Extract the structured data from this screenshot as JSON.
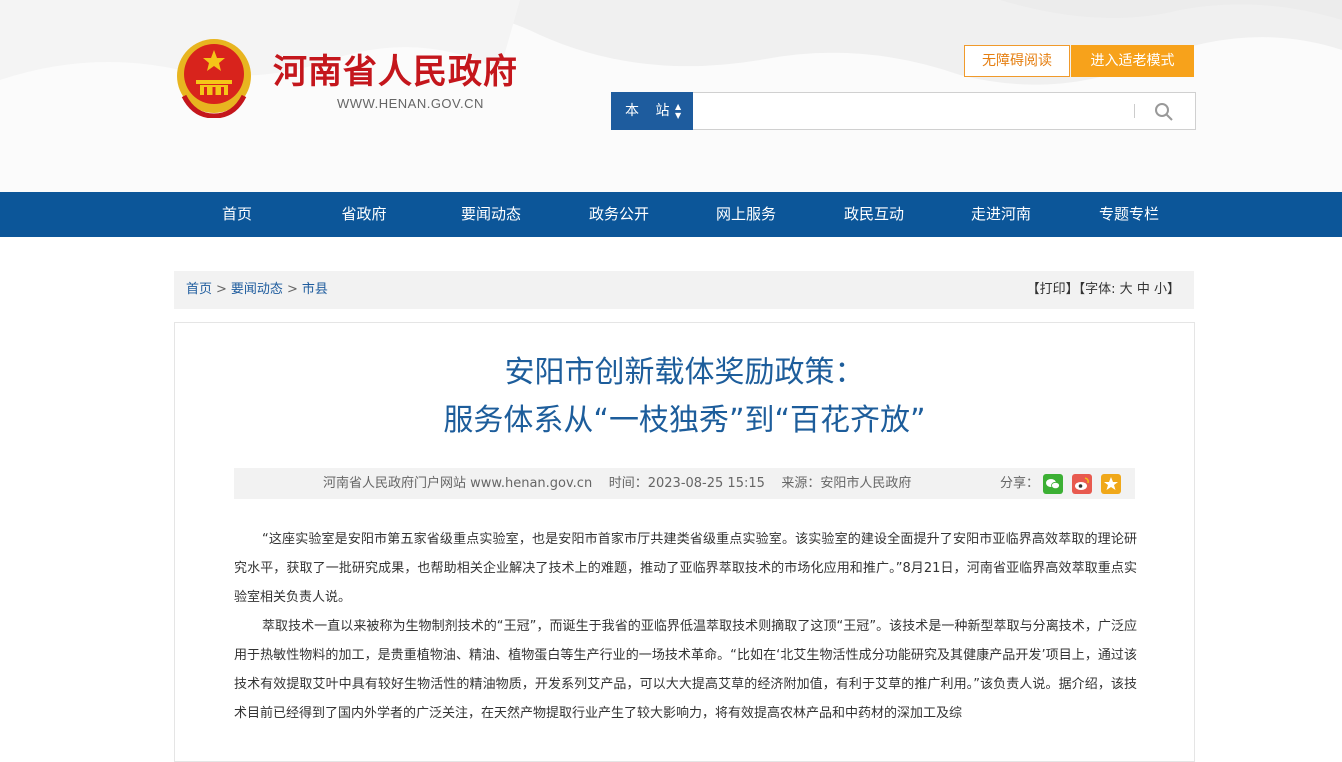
{
  "header": {
    "site_title": "河南省人民政府",
    "site_url": "WWW.HENAN.GOV.CN",
    "accessibility_button": "无障碍阅读",
    "elder_mode_button": "进入适老模式"
  },
  "search": {
    "scope": "本 站",
    "placeholder": ""
  },
  "nav": {
    "items": [
      "首页",
      "省政府",
      "要闻动态",
      "政务公开",
      "网上服务",
      "政民互动",
      "走进河南",
      "专题专栏"
    ]
  },
  "breadcrumb": {
    "items": [
      "首页",
      "要闻动态",
      "市县"
    ],
    "separator": ">",
    "print": "【打印】",
    "font_label": "【字体:",
    "font_large": "大",
    "font_medium": "中",
    "font_small": "小",
    "font_close": "】"
  },
  "article": {
    "title_line1": "安阳市创新载体奖励政策：",
    "title_line2": "服务体系从“一枝独秀”到“百花齐放”",
    "meta_source_site": "河南省人民政府门户网站 www.henan.gov.cn",
    "meta_time": "时间：2023-08-25 15:15",
    "meta_origin": "来源：安阳市人民政府",
    "share_label": "分享：",
    "paragraphs": [
      "“这座实验室是安阳市第五家省级重点实验室，也是安阳市首家市厅共建类省级重点实验室。该实验室的建设全面提升了安阳市亚临界高效萃取的理论研究水平，获取了一批研究成果，也帮助相关企业解决了技术上的难题，推动了亚临界萃取技术的市场化应用和推广。”8月21日，河南省亚临界高效萃取重点实验室相关负责人说。",
      "萃取技术一直以来被称为生物制剂技术的“王冠”，而诞生于我省的亚临界低温萃取技术则摘取了这顶“王冠”。该技术是一种新型萃取与分离技术，广泛应用于热敏性物料的加工，是贵重植物油、精油、植物蛋白等生产行业的一场技术革命。“比如在‘北艾生物活性成分功能研究及其健康产品开发’项目上，通过该技术有效提取艾叶中具有较好生物活性的精油物质，开发系列艾产品，可以大大提高艾草的经济附加值，有利于艾草的推广利用。”该负责人说。据介绍，该技术目前已经得到了国内外学者的广泛关注，在天然产物提取行业产生了较大影响力，将有效提高农林产品和中药材的深加工及综"
    ]
  },
  "colors": {
    "brand_red": "#c4161c",
    "nav_blue": "#0c5699",
    "title_blue": "#1d5d9b",
    "elder_orange": "#f7a21b"
  },
  "icons": [
    "national-emblem-icon",
    "search-icon",
    "wechat-icon",
    "weibo-icon",
    "favorite-star-icon"
  ]
}
